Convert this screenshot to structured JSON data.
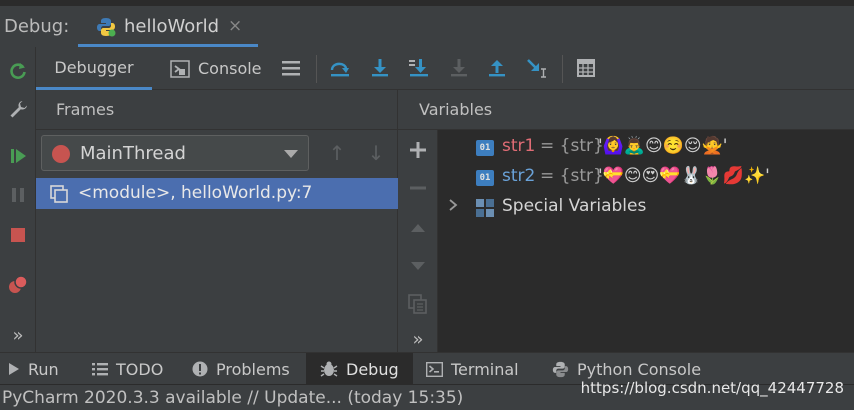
{
  "debug": {
    "label": "Debug:",
    "tab_title": "helloWorld",
    "close_glyph": "×"
  },
  "toolbar": {
    "tabs": [
      {
        "label": "Debugger"
      },
      {
        "label": "Console"
      }
    ],
    "icons": [
      "menu-icon",
      "show-execution-point-icon",
      "step-over-icon",
      "step-into-icon",
      "step-into-my-code-icon",
      "step-out-icon",
      "run-to-cursor-icon",
      "evaluate-expression-icon"
    ]
  },
  "left_strip": {
    "icons": [
      "rerun-icon",
      "settings-icon",
      "resume-icon",
      "pause-icon",
      "stop-icon",
      "view-breakpoints-icon",
      "more-icon"
    ],
    "more_glyph": "»"
  },
  "frames": {
    "header": "Frames",
    "thread": "MainThread",
    "up_glyph": "↑",
    "down_glyph": "↓",
    "rows": [
      {
        "label": "<module>, helloWorld.py:7"
      }
    ]
  },
  "variables": {
    "header": "Variables",
    "items": [
      {
        "badge": "01",
        "name": "str1",
        "type": "= {str}",
        "value": "'🙆‍♀️🙇‍♂️😊☺️😌🙅'",
        "color": "#e06c75"
      },
      {
        "badge": "01",
        "name": "str2",
        "type": "= {str}",
        "value": "'💝😊😍💝🐰🌷💋✨'",
        "color": "#6aa2d8"
      }
    ],
    "special_label": "Special Variables",
    "more_glyph": "»"
  },
  "bottombar": {
    "items": [
      {
        "label": "Run",
        "icon": "run-icon"
      },
      {
        "label": "TODO",
        "icon": "todo-icon"
      },
      {
        "label": "Problems",
        "icon": "problems-icon"
      },
      {
        "label": "Debug",
        "icon": "debug-icon"
      },
      {
        "label": "Terminal",
        "icon": "terminal-icon"
      },
      {
        "label": "Python Console",
        "icon": "python-console-icon"
      }
    ]
  },
  "status": {
    "message": "PyCharm 2020.3.3 available // Update... (today 15:35)",
    "watermark": "https://blog.csdn.net/qq_42447728"
  },
  "colors": {
    "accent": "#4a88c7",
    "selection": "#4b6eaf",
    "thread_dot": "#c75450",
    "resume": "#499c54",
    "stop": "#c75450"
  }
}
